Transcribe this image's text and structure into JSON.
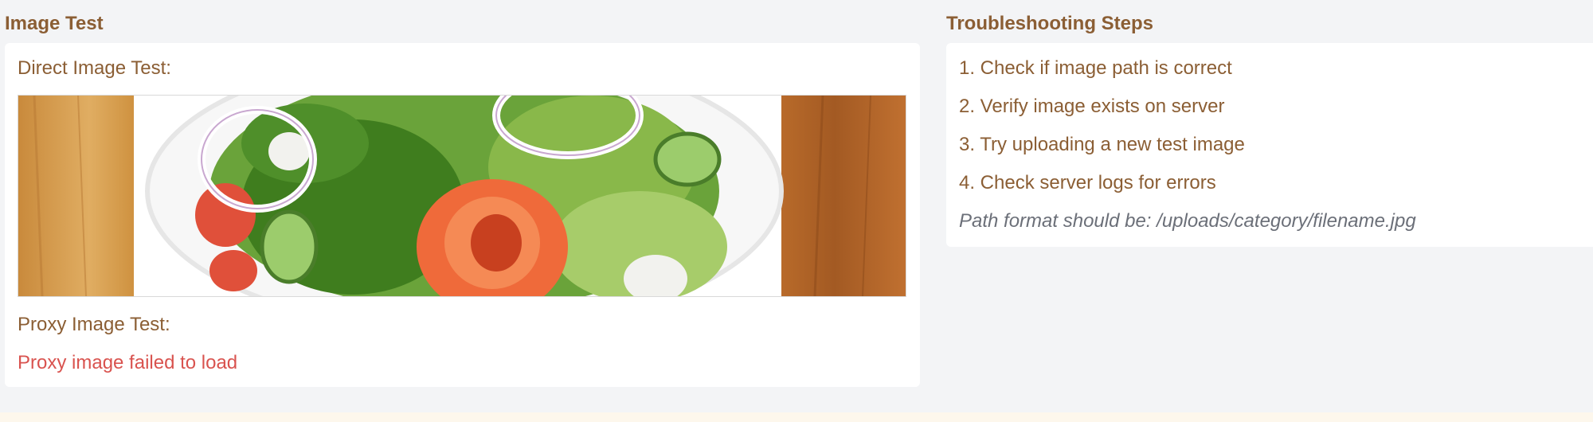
{
  "image_test": {
    "title": "Image Test",
    "direct_label": "Direct Image Test:",
    "image_description": "salad-photo",
    "proxy_label": "Proxy Image Test:",
    "proxy_error": "Proxy image failed to load"
  },
  "troubleshooting": {
    "title": "Troubleshooting Steps",
    "steps": [
      "1. Check if image path is correct",
      "2. Verify image exists on server",
      "3. Try uploading a new test image",
      "4. Check server logs for errors"
    ],
    "note": "Path format should be: /uploads/category/filename.jpg"
  },
  "colors": {
    "text_brown": "#8b5e34",
    "error_red": "#d9534f",
    "note_gray": "#6b6f78",
    "page_bg": "#f3f4f6"
  }
}
